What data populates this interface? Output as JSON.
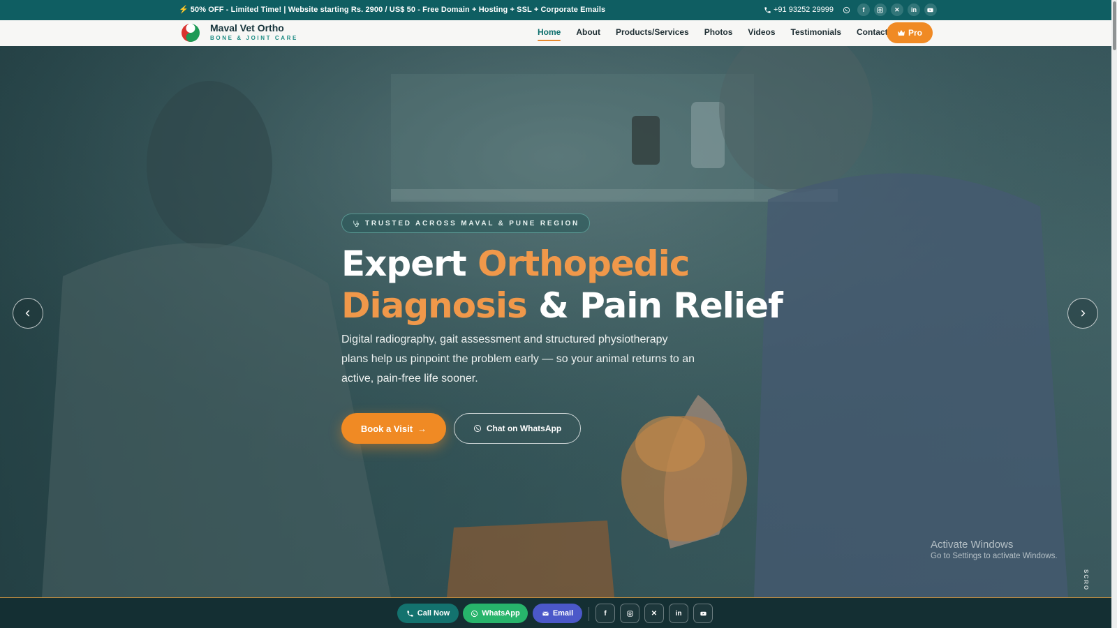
{
  "topbar": {
    "promo": "50% OFF - Limited Time! | Website starting Rs. 2900 / US$ 50 - Free Domain + Hosting + SSL + Corporate Emails",
    "phone": "+91 93252 29999",
    "social_icons": [
      "whatsapp-icon",
      "facebook-icon",
      "instagram-icon",
      "x-icon",
      "linkedin-icon",
      "youtube-icon"
    ]
  },
  "nav": {
    "brand_name": "Maval Vet Ortho",
    "brand_sub": "BONE & JOINT CARE",
    "items": [
      {
        "label": "Home",
        "active": true
      },
      {
        "label": "About"
      },
      {
        "label": "Products/Services"
      },
      {
        "label": "Photos"
      },
      {
        "label": "Videos"
      },
      {
        "label": "Testimonials"
      },
      {
        "label": "Contact"
      }
    ],
    "pro_label": "Pro"
  },
  "hero": {
    "badge": "TRUSTED ACROSS MAVAL & PUNE REGION",
    "headline_1": "Expert ",
    "headline_2": "Orthopedic",
    "headline_3": "Diagnosis",
    "headline_4": " & Pain Relief",
    "subtitle": "Digital radiography, gait assessment and structured physiotherapy plans help us pinpoint the problem early — so your animal returns to an active, pain-free life sooner.",
    "cta_primary": "Book a Visit",
    "cta_secondary": "Chat on WhatsApp",
    "scroll_label": "SCRO"
  },
  "watermark": {
    "title": "Activate Windows",
    "subtitle": "Go to Settings to activate Windows."
  },
  "bottombar": {
    "call_label": "Call Now",
    "whatsapp_label": "WhatsApp",
    "email_label": "Email",
    "social_icons": [
      "facebook-icon",
      "instagram-icon",
      "x-icon",
      "linkedin-icon",
      "youtube-icon"
    ]
  },
  "colors": {
    "accent": "#f08a24",
    "teal": "#0f5e62",
    "whatsapp": "#27b46b",
    "email": "#4b58c9"
  }
}
